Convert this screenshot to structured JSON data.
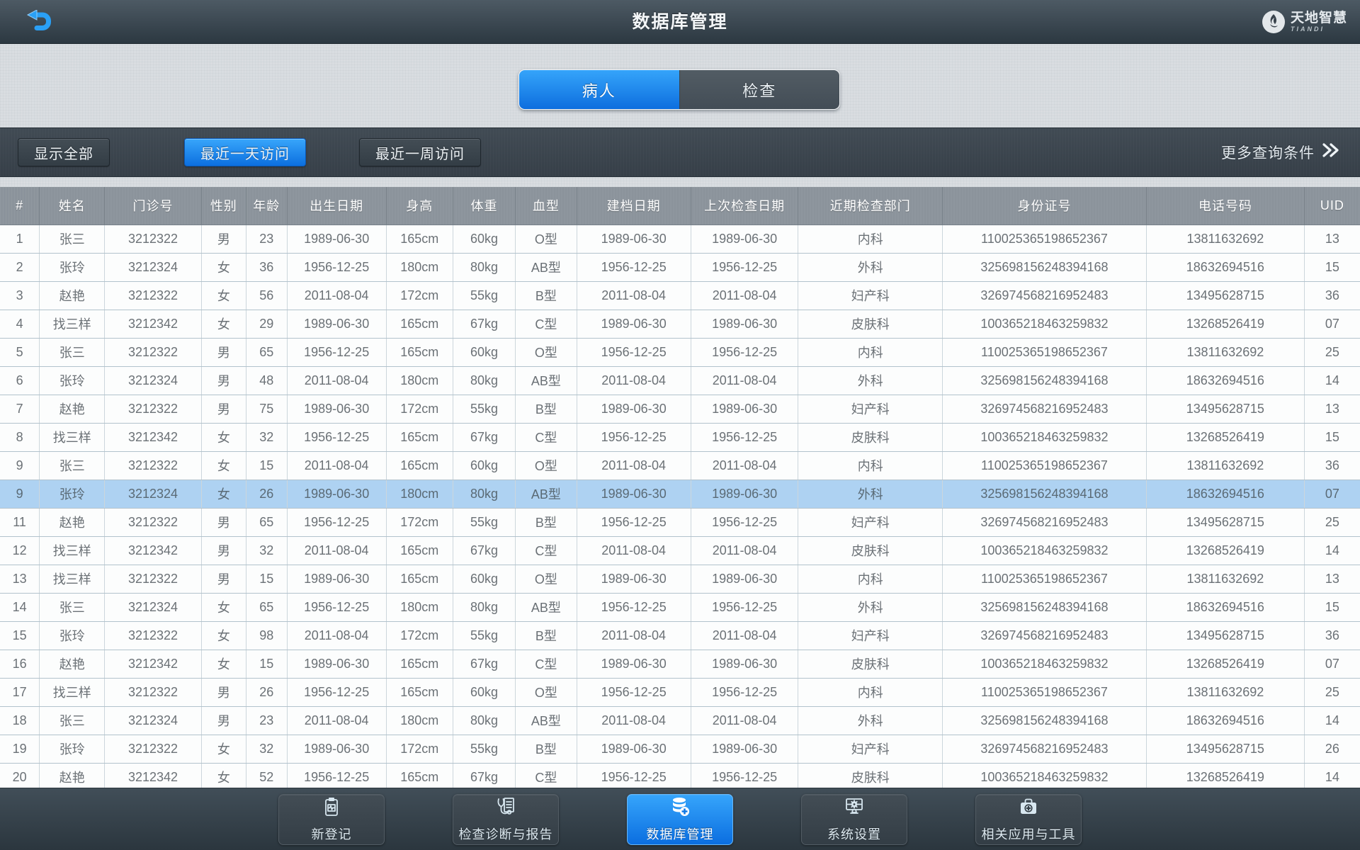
{
  "header": {
    "title": "数据库管理",
    "back_icon": "back-arrow-icon",
    "logo_text": "天地智慧",
    "logo_subtext": "TIANDI"
  },
  "tabs": [
    {
      "label": "病人",
      "active": true
    },
    {
      "label": "检查",
      "active": false
    }
  ],
  "filters": {
    "buttons": [
      {
        "label": "显示全部",
        "active": false
      },
      {
        "label": "最近一天访问",
        "active": true
      },
      {
        "label": "最近一周访问",
        "active": false
      }
    ],
    "more_label": "更多查询条件",
    "more_icon": "double-chevron-right-icon"
  },
  "colors": {
    "accent_blue": "#1e8cf0",
    "highlight_row": "#aed2f2",
    "topbar_dark": "#2c3841",
    "table_header_gray": "#8b939b"
  },
  "table": {
    "columns": [
      "#",
      "姓名",
      "门诊号",
      "性别",
      "年龄",
      "出生日期",
      "身高",
      "体重",
      "血型",
      "建档日期",
      "上次检查日期",
      "近期检查部门",
      "身份证号",
      "电话号码",
      "UID"
    ],
    "highlighted_row": 9,
    "rows": [
      [
        "1",
        "张三",
        "3212322",
        "男",
        "23",
        "1989-06-30",
        "165cm",
        "60kg",
        "O型",
        "1989-06-30",
        "1989-06-30",
        "内科",
        "110025365198652367",
        "13811632692",
        "13"
      ],
      [
        "2",
        "张玲",
        "3212324",
        "女",
        "36",
        "1956-12-25",
        "180cm",
        "80kg",
        "AB型",
        "1956-12-25",
        "1956-12-25",
        "外科",
        "325698156248394168",
        "18632694516",
        "15"
      ],
      [
        "3",
        "赵艳",
        "3212322",
        "女",
        "56",
        "2011-08-04",
        "172cm",
        "55kg",
        "B型",
        "2011-08-04",
        "2011-08-04",
        "妇产科",
        "326974568216952483",
        "13495628715",
        "36"
      ],
      [
        "4",
        "找三样",
        "3212342",
        "女",
        "29",
        "1989-06-30",
        "165cm",
        "67kg",
        "C型",
        "1989-06-30",
        "1989-06-30",
        "皮肤科",
        "100365218463259832",
        "13268526419",
        "07"
      ],
      [
        "5",
        "张三",
        "3212322",
        "男",
        "65",
        "1956-12-25",
        "165cm",
        "60kg",
        "O型",
        "1956-12-25",
        "1956-12-25",
        "内科",
        "110025365198652367",
        "13811632692",
        "25"
      ],
      [
        "6",
        "张玲",
        "3212324",
        "男",
        "48",
        "2011-08-04",
        "180cm",
        "80kg",
        "AB型",
        "2011-08-04",
        "2011-08-04",
        "外科",
        "325698156248394168",
        "18632694516",
        "14"
      ],
      [
        "7",
        "赵艳",
        "3212322",
        "男",
        "75",
        "1989-06-30",
        "172cm",
        "55kg",
        "B型",
        "1989-06-30",
        "1989-06-30",
        "妇产科",
        "326974568216952483",
        "13495628715",
        "13"
      ],
      [
        "8",
        "找三样",
        "3212342",
        "女",
        "32",
        "1956-12-25",
        "165cm",
        "67kg",
        "C型",
        "1956-12-25",
        "1956-12-25",
        "皮肤科",
        "100365218463259832",
        "13268526419",
        "15"
      ],
      [
        "9",
        "张三",
        "3212322",
        "女",
        "15",
        "2011-08-04",
        "165cm",
        "60kg",
        "O型",
        "2011-08-04",
        "2011-08-04",
        "内科",
        "110025365198652367",
        "13811632692",
        "36"
      ],
      [
        "9",
        "张玲",
        "3212324",
        "女",
        "26",
        "1989-06-30",
        "180cm",
        "80kg",
        "AB型",
        "1989-06-30",
        "1989-06-30",
        "外科",
        "325698156248394168",
        "18632694516",
        "07"
      ],
      [
        "11",
        "赵艳",
        "3212322",
        "男",
        "65",
        "1956-12-25",
        "172cm",
        "55kg",
        "B型",
        "1956-12-25",
        "1956-12-25",
        "妇产科",
        "326974568216952483",
        "13495628715",
        "25"
      ],
      [
        "12",
        "找三样",
        "3212342",
        "男",
        "32",
        "2011-08-04",
        "165cm",
        "67kg",
        "C型",
        "2011-08-04",
        "2011-08-04",
        "皮肤科",
        "100365218463259832",
        "13268526419",
        "14"
      ],
      [
        "13",
        "找三样",
        "3212322",
        "男",
        "15",
        "1989-06-30",
        "165cm",
        "60kg",
        "O型",
        "1989-06-30",
        "1989-06-30",
        "内科",
        "110025365198652367",
        "13811632692",
        "13"
      ],
      [
        "14",
        "张三",
        "3212324",
        "女",
        "65",
        "1956-12-25",
        "180cm",
        "80kg",
        "AB型",
        "1956-12-25",
        "1956-12-25",
        "外科",
        "325698156248394168",
        "18632694516",
        "15"
      ],
      [
        "15",
        "张玲",
        "3212322",
        "女",
        "98",
        "2011-08-04",
        "172cm",
        "55kg",
        "B型",
        "2011-08-04",
        "2011-08-04",
        "妇产科",
        "326974568216952483",
        "13495628715",
        "36"
      ],
      [
        "16",
        "赵艳",
        "3212342",
        "女",
        "15",
        "1989-06-30",
        "165cm",
        "67kg",
        "C型",
        "1989-06-30",
        "1989-06-30",
        "皮肤科",
        "100365218463259832",
        "13268526419",
        "07"
      ],
      [
        "17",
        "找三样",
        "3212322",
        "男",
        "26",
        "1956-12-25",
        "165cm",
        "60kg",
        "O型",
        "1956-12-25",
        "1956-12-25",
        "内科",
        "110025365198652367",
        "13811632692",
        "25"
      ],
      [
        "18",
        "张三",
        "3212324",
        "男",
        "23",
        "2011-08-04",
        "180cm",
        "80kg",
        "AB型",
        "2011-08-04",
        "2011-08-04",
        "外科",
        "325698156248394168",
        "18632694516",
        "14"
      ],
      [
        "19",
        "张玲",
        "3212322",
        "女",
        "32",
        "1989-06-30",
        "172cm",
        "55kg",
        "B型",
        "1989-06-30",
        "1989-06-30",
        "妇产科",
        "326974568216952483",
        "13495628715",
        "26"
      ],
      [
        "20",
        "赵艳",
        "3212342",
        "女",
        "52",
        "1956-12-25",
        "165cm",
        "67kg",
        "C型",
        "1956-12-25",
        "1956-12-25",
        "皮肤科",
        "100365218463259832",
        "13268526419",
        "14"
      ]
    ]
  },
  "bottom_nav": {
    "items": [
      {
        "label": "新登记",
        "icon": "registration-clipboard-icon",
        "active": false
      },
      {
        "label": "检查诊断与报告",
        "icon": "diagnosis-report-icon",
        "active": false
      },
      {
        "label": "数据库管理",
        "icon": "database-icon",
        "active": true
      },
      {
        "label": "系统设置",
        "icon": "system-settings-icon",
        "active": false
      },
      {
        "label": "相关应用与工具",
        "icon": "tools-bag-icon",
        "active": false
      }
    ]
  }
}
